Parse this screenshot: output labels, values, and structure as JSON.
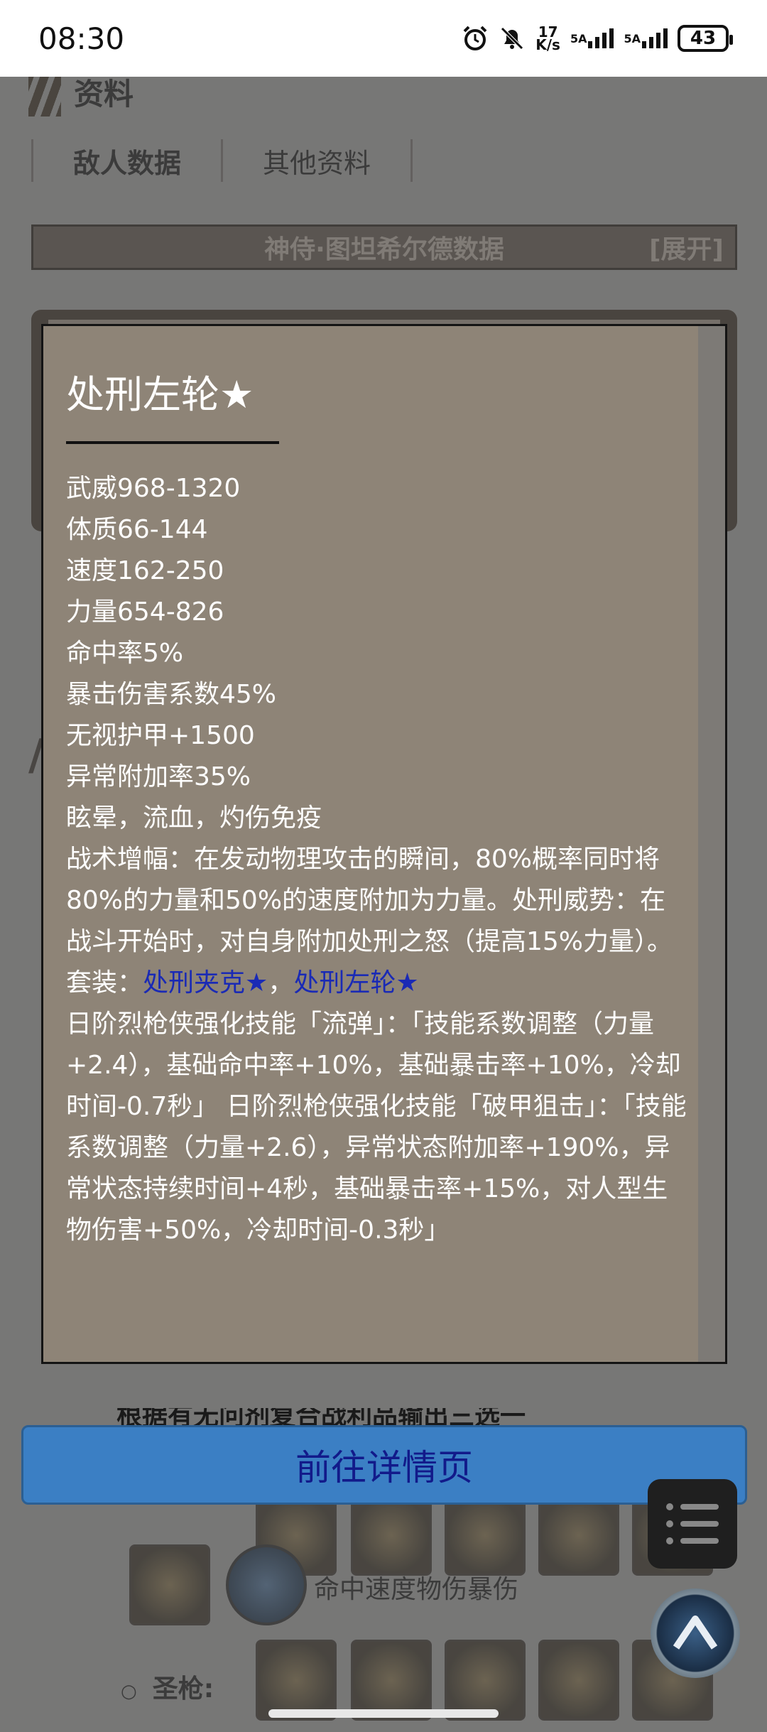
{
  "status_bar": {
    "time": "08:30",
    "net_speed_value": "17",
    "net_speed_unit": "K/s",
    "sim1_label": "5A",
    "sim2_label": "5A",
    "battery": "43",
    "icons": [
      "alarm-icon",
      "mute-icon",
      "signal-icon",
      "battery-icon"
    ]
  },
  "page": {
    "heading": "资料",
    "tabs": [
      {
        "label": "敌人数据",
        "active": true
      },
      {
        "label": "其他资料",
        "active": false
      }
    ],
    "enemy_banner": {
      "title": "神侍·图坦希尔德数据",
      "expand": "[展开]"
    },
    "background_fragments": {
      "row_text": "命中速度物伤暴伤",
      "sacred_gun_label": "圣枪:",
      "partial_text": "根据有无问剂复合战利品输出三选一"
    }
  },
  "popup": {
    "title": "处刑左轮",
    "title_star": "★",
    "stats": [
      "武威968-1320",
      "体质66-144",
      "速度162-250",
      "力量654-826",
      "命中率5%",
      "暴击伤害系数45%",
      "无视护甲+1500",
      "异常附加率35%",
      "眩晕，流血，灼伤免疫"
    ],
    "description": "战术增幅：在发动物理攻击的瞬间，80%概率同时将80%的力量和50%的速度附加为力量。处刑威势：在战斗开始时，对自身附加处刑之怒（提高15%力量）。",
    "set_prefix": "套装：",
    "set_items": [
      "处刑夹克★",
      "处刑左轮★"
    ],
    "set_separator": "，",
    "skills": "日阶烈枪侠强化技能「流弹」：「技能系数调整（力量+2.4），基础命中率+10%，基础暴击率+10%，冷却时间-0.7秒」 日阶烈枪侠强化技能「破甲狙击」：「技能系数调整（力量+2.6），异常状态附加率+190%，异常状态持续时间+4秒，基础暴击率+15%，对人型生物伤害+50%，冷却时间-0.3秒」"
  },
  "detail_button": "前往详情页",
  "fab": {
    "menu_icon": "list-menu-icon",
    "up_icon": "scroll-top-icon"
  }
}
